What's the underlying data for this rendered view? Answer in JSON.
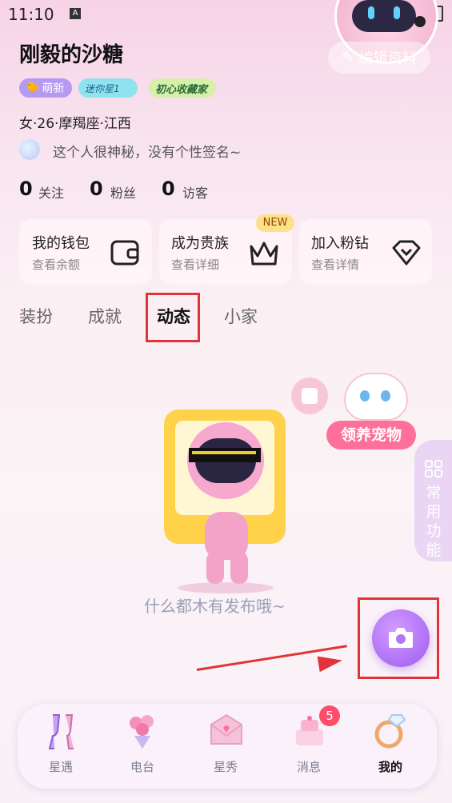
{
  "status_bar": {
    "time": "11:10",
    "a_icon": "A"
  },
  "profile": {
    "username": "刚毅的沙糖",
    "edit_label": "编辑资料",
    "badges": [
      "萌新",
      "迷你星1",
      "初心收藏家"
    ],
    "info": "女·26·摩羯座·江西",
    "signature": "这个人很神秘，没有个性签名~",
    "stats": [
      {
        "value": "0",
        "label": "关注"
      },
      {
        "value": "0",
        "label": "粉丝"
      },
      {
        "value": "0",
        "label": "访客"
      }
    ]
  },
  "cards": [
    {
      "title": "我的钱包",
      "sub": "查看余额",
      "icon": "wallet-icon"
    },
    {
      "title": "成为贵族",
      "sub": "查看详细",
      "icon": "crown-icon",
      "badge": "NEW"
    },
    {
      "title": "加入粉钻",
      "sub": "查看详情",
      "icon": "diamond-icon"
    }
  ],
  "tabs": [
    "装扮",
    "成就",
    "动态",
    "小家"
  ],
  "active_tab": "动态",
  "pet_label": "领养宠物",
  "side_panel_label": "常用功能",
  "empty_text": "什么都木有发布哦~",
  "nav": [
    {
      "label": "星遇",
      "icon": "champagne-icon"
    },
    {
      "label": "电台",
      "icon": "flowers-icon"
    },
    {
      "label": "星秀",
      "icon": "envelope-icon"
    },
    {
      "label": "消息",
      "icon": "cake-icon",
      "badge": "5"
    },
    {
      "label": "我的",
      "icon": "ring-icon",
      "active": true
    }
  ],
  "colors": {
    "accent": "#9d5cf0",
    "annotation": "#e0343a",
    "badge": "#ff4d6a"
  }
}
